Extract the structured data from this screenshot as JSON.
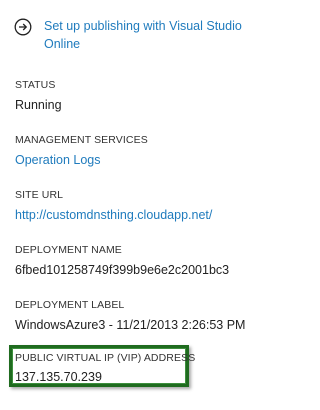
{
  "publish_link": {
    "icon": "arrow-right-circle-icon",
    "label": "Set up publishing with Visual Studio Online"
  },
  "status": {
    "label": "STATUS",
    "value": "Running"
  },
  "management_services": {
    "label": "MANAGEMENT SERVICES",
    "link": "Operation Logs"
  },
  "site_url": {
    "label": "SITE URL",
    "link": "http://customdnsthing.cloudapp.net/"
  },
  "deployment_name": {
    "label": "DEPLOYMENT NAME",
    "value": "6fbed101258749f399b9e6e2c2001bc3"
  },
  "deployment_label": {
    "label": "DEPLOYMENT LABEL",
    "value": "WindowsAzure3 - 11/21/2013 2:26:53 PM"
  },
  "vip": {
    "label": "PUBLIC VIRTUAL IP (VIP) ADDRESS",
    "value": "137.135.70.239"
  },
  "colors": {
    "link": "#1f7bbd",
    "highlight_border": "#1f6b1f"
  }
}
